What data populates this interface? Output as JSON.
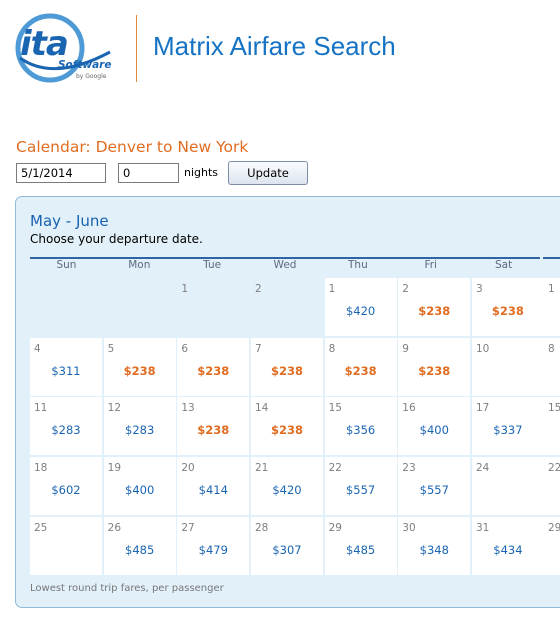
{
  "header": {
    "logo_text": "ita",
    "logo_sub": "Software",
    "logo_by": "by Google",
    "app_title": "Matrix Airfare Search"
  },
  "search": {
    "heading": "Calendar: Denver to New York",
    "date_value": "5/1/2014",
    "nights_value": "0",
    "nights_label": "nights",
    "update_label": "Update"
  },
  "calendar": {
    "month_title": "May - June",
    "subtitle": "Choose your departure date.",
    "weekdays": [
      "Sun",
      "Mon",
      "Tue",
      "Wed",
      "Thu",
      "Fri",
      "Sat"
    ],
    "footnote": "Lowest round trip fares, per passenger",
    "weeks": [
      [
        {
          "day": "",
          "fare": "",
          "state": "empty"
        },
        {
          "day": "",
          "fare": "",
          "state": "empty"
        },
        {
          "day": "1",
          "fare": "",
          "state": "disabled"
        },
        {
          "day": "2",
          "fare": "",
          "state": "disabled"
        },
        {
          "day": "1",
          "fare": "$420",
          "state": "normal"
        },
        {
          "day": "2",
          "fare": "$238",
          "state": "low"
        },
        {
          "day": "3",
          "fare": "$238",
          "state": "low"
        }
      ],
      [
        {
          "day": "4",
          "fare": "$311",
          "state": "normal"
        },
        {
          "day": "5",
          "fare": "$238",
          "state": "low"
        },
        {
          "day": "6",
          "fare": "$238",
          "state": "low"
        },
        {
          "day": "7",
          "fare": "$238",
          "state": "low"
        },
        {
          "day": "8",
          "fare": "$238",
          "state": "low"
        },
        {
          "day": "9",
          "fare": "$238",
          "state": "low"
        },
        {
          "day": "10",
          "fare": "",
          "state": "normal"
        }
      ],
      [
        {
          "day": "11",
          "fare": "$283",
          "state": "normal"
        },
        {
          "day": "12",
          "fare": "$283",
          "state": "normal"
        },
        {
          "day": "13",
          "fare": "$238",
          "state": "low"
        },
        {
          "day": "14",
          "fare": "$238",
          "state": "low"
        },
        {
          "day": "15",
          "fare": "$356",
          "state": "normal"
        },
        {
          "day": "16",
          "fare": "$400",
          "state": "normal"
        },
        {
          "day": "17",
          "fare": "$337",
          "state": "normal"
        }
      ],
      [
        {
          "day": "18",
          "fare": "$602",
          "state": "normal"
        },
        {
          "day": "19",
          "fare": "$400",
          "state": "normal"
        },
        {
          "day": "20",
          "fare": "$414",
          "state": "normal"
        },
        {
          "day": "21",
          "fare": "$420",
          "state": "normal"
        },
        {
          "day": "22",
          "fare": "$557",
          "state": "normal"
        },
        {
          "day": "23",
          "fare": "$557",
          "state": "normal"
        },
        {
          "day": "24",
          "fare": "",
          "state": "normal"
        }
      ],
      [
        {
          "day": "25",
          "fare": "",
          "state": "normal"
        },
        {
          "day": "26",
          "fare": "$485",
          "state": "normal"
        },
        {
          "day": "27",
          "fare": "$479",
          "state": "normal"
        },
        {
          "day": "28",
          "fare": "$307",
          "state": "normal"
        },
        {
          "day": "29",
          "fare": "$485",
          "state": "normal"
        },
        {
          "day": "30",
          "fare": "$348",
          "state": "normal"
        },
        {
          "day": "31",
          "fare": "$434",
          "state": "normal"
        }
      ]
    ],
    "next_month_days": [
      "1",
      "8",
      "15",
      "22",
      "29"
    ]
  },
  "colors": {
    "title_blue": "#1673c4",
    "heading_orange": "#e06d22",
    "fare_blue": "#1a65b2",
    "panel_bg": "#e1f0f9"
  }
}
